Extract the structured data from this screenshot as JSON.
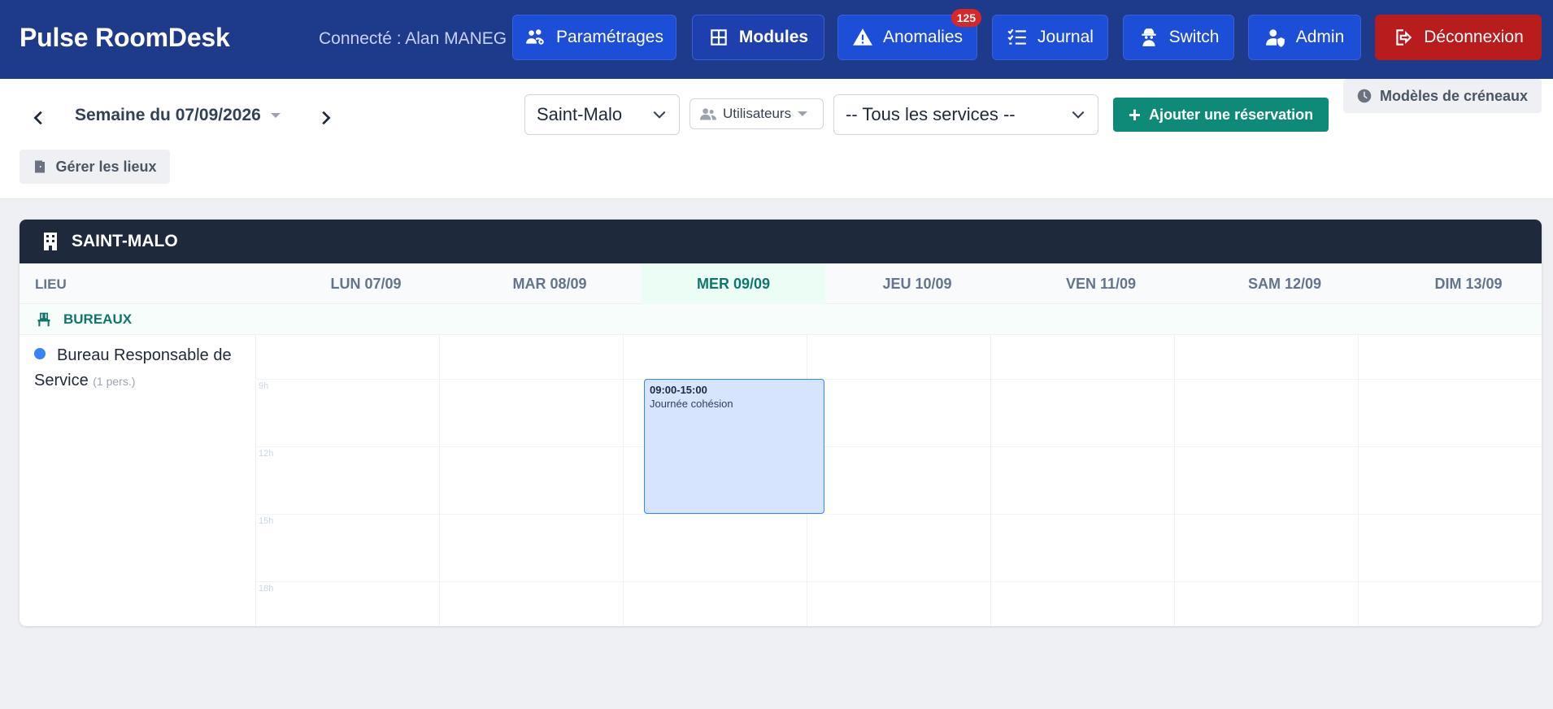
{
  "header": {
    "brand": "Pulse RoomDesk",
    "connected": "Connecté : Alan MANEG",
    "nav": [
      {
        "label": "Paramétrages",
        "icon": "users-gear-icon"
      },
      {
        "label": "Modules",
        "icon": "grid-icon"
      },
      {
        "label": "Anomalies",
        "icon": "warning-icon",
        "badge": "125"
      },
      {
        "label": "Journal",
        "icon": "list-check-icon"
      },
      {
        "label": "Switch",
        "icon": "user-secret-icon"
      },
      {
        "label": "Admin",
        "icon": "user-shield-icon"
      },
      {
        "label": "Déconnexion",
        "icon": "logout-icon"
      }
    ]
  },
  "toolbar": {
    "week_label": "Semaine du 07/09/2026",
    "site": "Saint-Malo",
    "users_label": "Utilisateurs",
    "services": "-- Tous les services --",
    "add_label": "Ajouter une réservation",
    "templates_label": "Modèles de créneaux",
    "manage_label": "Gérer les lieux"
  },
  "calendar": {
    "site_title": "SAINT-MALO",
    "lieu_header": "LIEU",
    "days": [
      "LUN 07/09",
      "MAR 08/09",
      "MER 09/09",
      "JEU 10/09",
      "VEN 11/09",
      "SAM 12/09",
      "DIM 13/09"
    ],
    "today_index": 2,
    "group": "BUREAUX",
    "room": {
      "name": "Bureau Responsable de Service",
      "capacity": "(1 pers.)"
    },
    "hours": [
      "9h",
      "12h",
      "15h",
      "18h"
    ],
    "event": {
      "time": "09:00-15:00",
      "title": "Journée cohésion"
    }
  },
  "colors": {
    "nav_bg": "#1e3a8a",
    "accent_green": "#0f8a78",
    "logout_red": "#b91c1c",
    "event_blue": "#d6e4fd"
  }
}
